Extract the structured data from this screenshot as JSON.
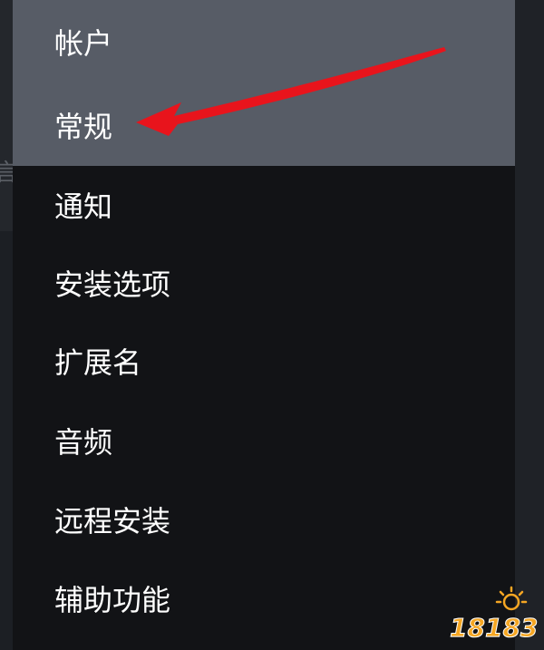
{
  "menu": {
    "items": [
      {
        "label": "帐户",
        "active": true
      },
      {
        "label": "常规",
        "active": true
      },
      {
        "label": "通知",
        "active": false
      },
      {
        "label": "安装选项",
        "active": false
      },
      {
        "label": "扩展名",
        "active": false
      },
      {
        "label": "音频",
        "active": false
      },
      {
        "label": "远程安装",
        "active": false
      },
      {
        "label": "辅助功能",
        "active": false
      }
    ]
  },
  "colors": {
    "menu_background": "#121316",
    "highlight": "#575c66",
    "text": "#ffffff",
    "annotation_arrow": "#e8141c",
    "watermark": "#f5a623"
  },
  "annotation": {
    "icon": "red-arrow-icon"
  },
  "watermark": {
    "text": "18183",
    "icon": "sun-logo-icon"
  }
}
